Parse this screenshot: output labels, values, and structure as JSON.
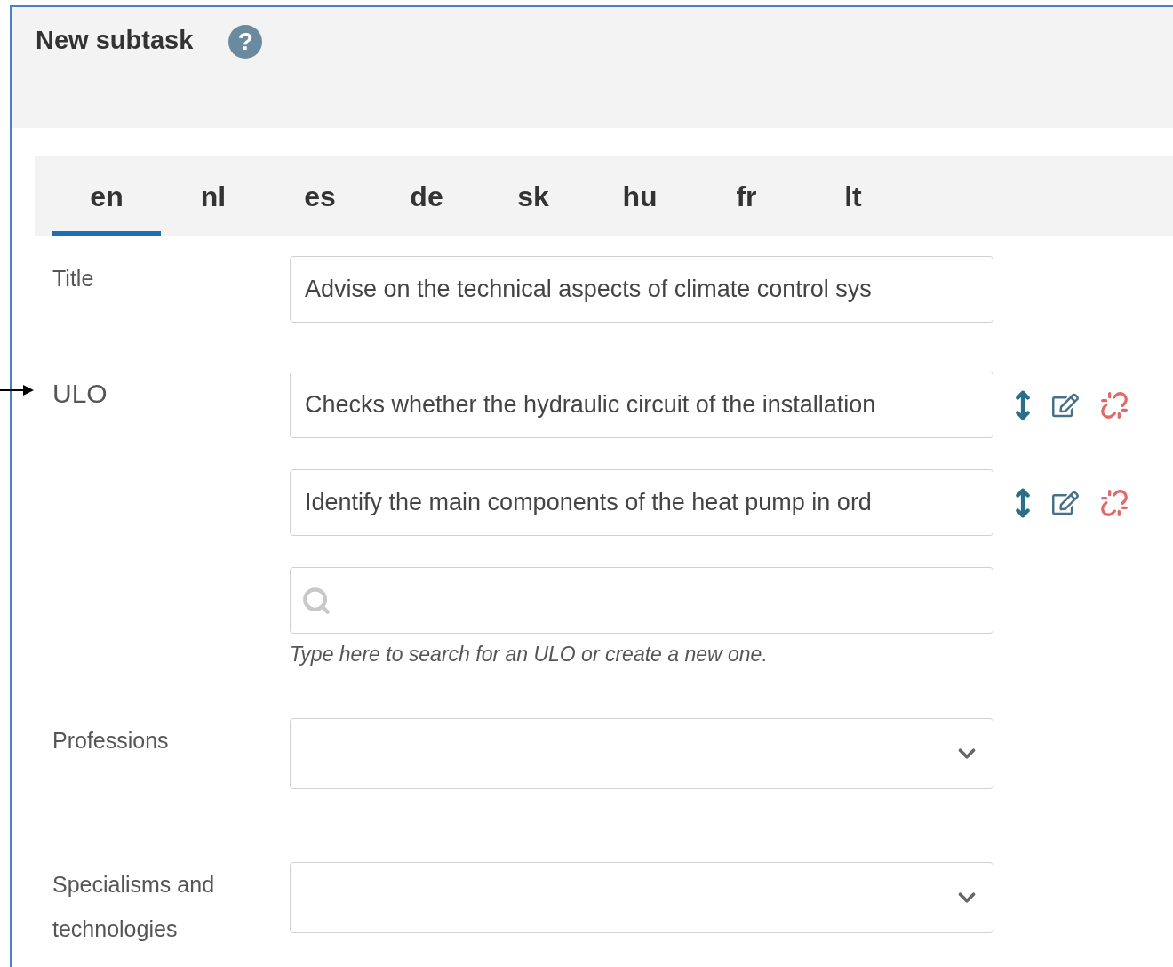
{
  "header": {
    "title": "New subtask",
    "help": "?"
  },
  "tabs": [
    {
      "label": "en",
      "selected": true
    },
    {
      "label": "nl",
      "selected": false
    },
    {
      "label": "es",
      "selected": false
    },
    {
      "label": "de",
      "selected": false
    },
    {
      "label": "sk",
      "selected": false
    },
    {
      "label": "hu",
      "selected": false
    },
    {
      "label": "fr",
      "selected": false
    },
    {
      "label": "lt",
      "selected": false
    }
  ],
  "fields": [
    {
      "kind": "text",
      "label": "Title",
      "value": "Advise on the technical aspects of climate control sys"
    },
    {
      "kind": "ulo",
      "label": "ULO",
      "items": [
        "Checks whether the hydraulic circuit of the installation",
        "Identify the main components of the heat pump in ord"
      ],
      "hint": "Type here to search for an ULO or create a new one."
    },
    {
      "kind": "select",
      "label": "Professions"
    },
    {
      "kind": "select",
      "label": "Specialisms and technologies"
    }
  ]
}
